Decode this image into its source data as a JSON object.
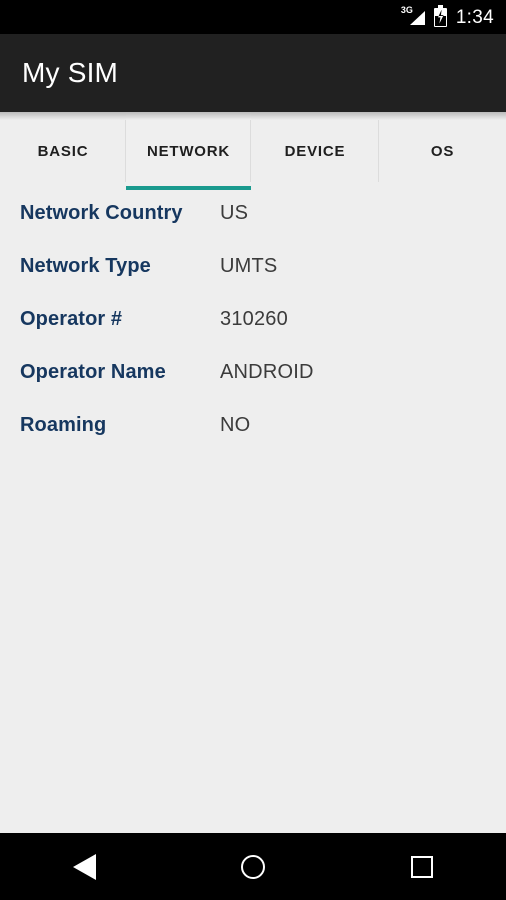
{
  "status_bar": {
    "signal_label": "3G",
    "signal_icon": "signal-bars-icon",
    "battery_icon": "battery-charging-icon",
    "clock": "1:34"
  },
  "app_bar": {
    "title": "My SIM"
  },
  "tabs": {
    "active_index": 1,
    "accent_color": "#1a9a8e",
    "items": [
      {
        "label": "BASIC"
      },
      {
        "label": "NETWORK"
      },
      {
        "label": "DEVICE"
      },
      {
        "label": "OS"
      }
    ]
  },
  "content": {
    "rows": [
      {
        "label": "Network Country",
        "value": "US"
      },
      {
        "label": "Network Type",
        "value": "UMTS"
      },
      {
        "label": "Operator #",
        "value": "310260"
      },
      {
        "label": "Operator Name",
        "value": "ANDROID"
      },
      {
        "label": "Roaming",
        "value": "NO"
      }
    ]
  },
  "nav_bar": {
    "back_label": "Back",
    "home_label": "Home",
    "recents_label": "Recent apps"
  },
  "colors": {
    "label_blue": "#16375f",
    "value_gray": "#3b3b3b",
    "app_bar": "#212121",
    "background": "#eeeeee"
  }
}
